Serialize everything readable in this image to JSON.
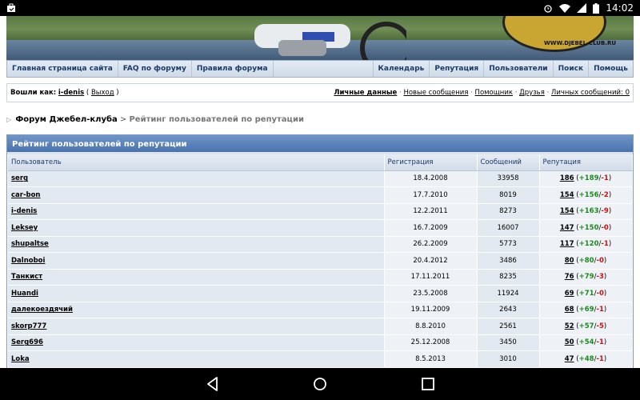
{
  "status": {
    "time": "14:02",
    "left_icon": "bag-icon",
    "icons": [
      "alarm-icon",
      "wifi-icon",
      "signal-icon",
      "battery-icon"
    ]
  },
  "nav": {
    "left": [
      "Главная страница сайта",
      "FAQ по форуму",
      "Правила форума"
    ],
    "right": [
      "Календарь",
      "Репутация",
      "Пользователи",
      "Поиск",
      "Помощь"
    ]
  },
  "banner": {
    "logo_text": "WWW.DJEBEL-CLUB.RU"
  },
  "userbar": {
    "logged_as": "Вошли как:",
    "username": "i-denis",
    "logout": "Выход",
    "links": [
      "Личные данные",
      "Новые сообщения",
      "Помощник",
      "Друзья",
      "Личных сообщений: 0"
    ]
  },
  "breadcrumb": {
    "forum": "Форум Джебел-клуба",
    "separator": ">",
    "current": "Рейтинг пользователей по репутации"
  },
  "table": {
    "title": "Рейтинг пользователей по репутации",
    "headers": [
      "Пользователь",
      "Регистрация",
      "Сообщений",
      "Репутация"
    ],
    "rows": [
      {
        "user": "serg",
        "reg": "18.4.2008",
        "msgs": "33958",
        "rep": "186",
        "plus": "+189",
        "minus": "-1"
      },
      {
        "user": "car-bon",
        "reg": "17.7.2010",
        "msgs": "8019",
        "rep": "154",
        "plus": "+156",
        "minus": "-2"
      },
      {
        "user": "i-denis",
        "reg": "12.2.2011",
        "msgs": "8273",
        "rep": "154",
        "plus": "+163",
        "minus": "-9"
      },
      {
        "user": "Leksey",
        "reg": "16.7.2009",
        "msgs": "16007",
        "rep": "147",
        "plus": "+150",
        "minus": "-0"
      },
      {
        "user": "shupaltse",
        "reg": "26.2.2009",
        "msgs": "5773",
        "rep": "117",
        "plus": "+120",
        "minus": "-1"
      },
      {
        "user": "Dalnoboi",
        "reg": "20.4.2012",
        "msgs": "3486",
        "rep": "80",
        "plus": "+80",
        "minus": "-0"
      },
      {
        "user": "Танкист",
        "reg": "17.11.2011",
        "msgs": "8235",
        "rep": "76",
        "plus": "+79",
        "minus": "-3"
      },
      {
        "user": "Huandi",
        "reg": "23.5.2008",
        "msgs": "11924",
        "rep": "69",
        "plus": "+71",
        "minus": "-0"
      },
      {
        "user": "далекоездячий",
        "reg": "19.11.2009",
        "msgs": "2643",
        "rep": "68",
        "plus": "+69",
        "minus": "-1"
      },
      {
        "user": "skorp777",
        "reg": "8.8.2010",
        "msgs": "2561",
        "rep": "52",
        "plus": "+57",
        "minus": "-5"
      },
      {
        "user": "Serg696",
        "reg": "25.12.2008",
        "msgs": "3450",
        "rep": "50",
        "plus": "+54",
        "minus": "-1"
      },
      {
        "user": "Loka",
        "reg": "8.5.2013",
        "msgs": "3010",
        "rep": "47",
        "plus": "+48",
        "minus": "-1"
      }
    ]
  },
  "android_nav": [
    "back-icon",
    "home-icon",
    "recents-icon"
  ]
}
